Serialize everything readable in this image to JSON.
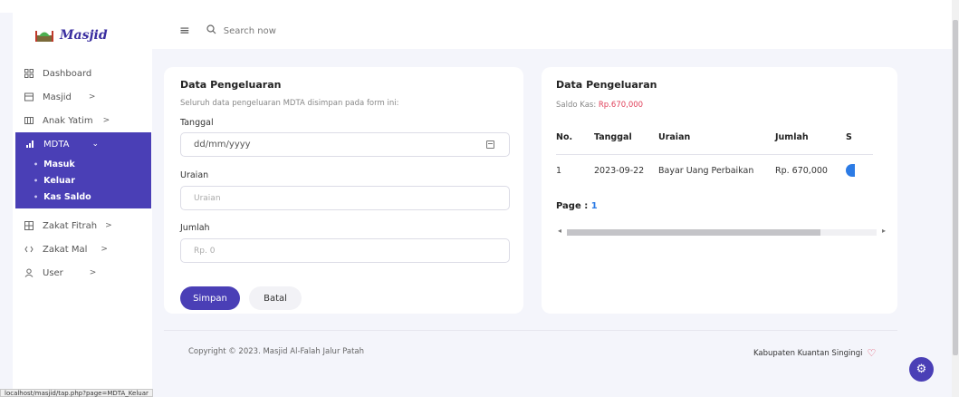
{
  "brand": {
    "logo_text": "Masjid"
  },
  "header": {
    "search_placeholder": "Search now"
  },
  "sidebar": {
    "items": [
      {
        "label": "Dashboard",
        "icon": "grid-icon",
        "chevron": ""
      },
      {
        "label": "Masjid",
        "icon": "building-icon",
        "chevron": ">"
      },
      {
        "label": "Anak Yatim",
        "icon": "columns-icon",
        "chevron": ">"
      }
    ],
    "active": {
      "label": "MDTA",
      "icon": "bar-chart-icon",
      "chevron": "⌄",
      "sub": [
        "Masuk",
        "Keluar",
        "Kas Saldo"
      ]
    },
    "items_after": [
      {
        "label": "Zakat Fitrah",
        "icon": "table-icon",
        "chevron": ">"
      },
      {
        "label": "Zakat Mal",
        "icon": "code-icon",
        "chevron": ">"
      },
      {
        "label": "User",
        "icon": "user-icon",
        "chevron": ">"
      }
    ]
  },
  "form": {
    "title": "Data Pengeluaran",
    "subtitle": "Seluruh data pengeluaran MDTA disimpan pada form ini:",
    "tanggal_label": "Tanggal",
    "tanggal_value": "dd/mm/yyyy",
    "uraian_label": "Uraian",
    "uraian_placeholder": "Uraian",
    "jumlah_label": "Jumlah",
    "jumlah_placeholder": "Rp. 0",
    "save_label": "Simpan",
    "cancel_label": "Batal"
  },
  "list": {
    "title": "Data Pengeluaran",
    "saldo_label": "Saldo Kas:",
    "saldo_value": "Rp.670,000",
    "columns": [
      "No.",
      "Tanggal",
      "Uraian",
      "Jumlah",
      "S"
    ],
    "rows": [
      {
        "no": "1",
        "tanggal": "2023-09-22",
        "uraian": "Bayar Uang Perbaikan",
        "jumlah": "Rp. 670,000"
      }
    ],
    "page_label": "Page :",
    "page_num": "1"
  },
  "footer": {
    "copyright": "Copyright © 2023. Masjid Al-Falah Jalur Patah",
    "location": "Kabupaten Kuantan Singingi"
  },
  "status_url": "localhost/masjid/tap.php?page=MDTA_Keluar",
  "colors": {
    "accent": "#4a3fb6",
    "saldo": "#e0405a",
    "link": "#2c7be5"
  }
}
